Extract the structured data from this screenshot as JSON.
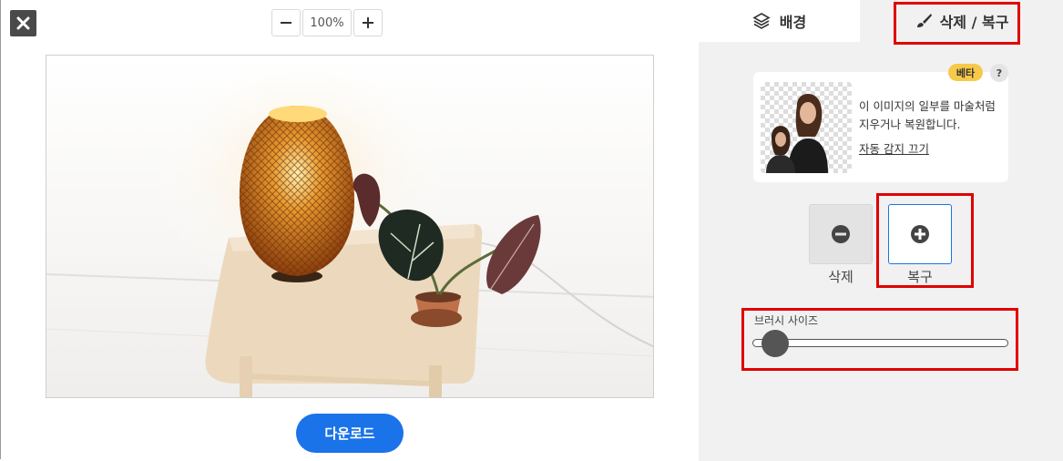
{
  "toolbar": {
    "zoom_minus": "−",
    "zoom_value": "100%",
    "zoom_plus": "+",
    "download_label": "다운로드"
  },
  "tabs": {
    "background_label": "배경",
    "erase_restore_label": "삭제 / 복구",
    "active": "erase_restore"
  },
  "info_card": {
    "badge": "베타",
    "help": "?",
    "description": "이 이미지의 일부를 마술처럼 지우거나 복원합니다.",
    "link": "자동 감지 끄기"
  },
  "modes": {
    "erase_label": "삭제",
    "restore_label": "복구",
    "selected": "restore"
  },
  "brush": {
    "label": "브러시 사이즈",
    "level": 0.05
  },
  "colors": {
    "accent": "#1a73e8",
    "highlight": "#e00000",
    "beta_badge": "#f7c948"
  },
  "icons": [
    "close-icon",
    "layers-icon",
    "brush-icon",
    "minus-circle-icon",
    "plus-circle-icon"
  ]
}
